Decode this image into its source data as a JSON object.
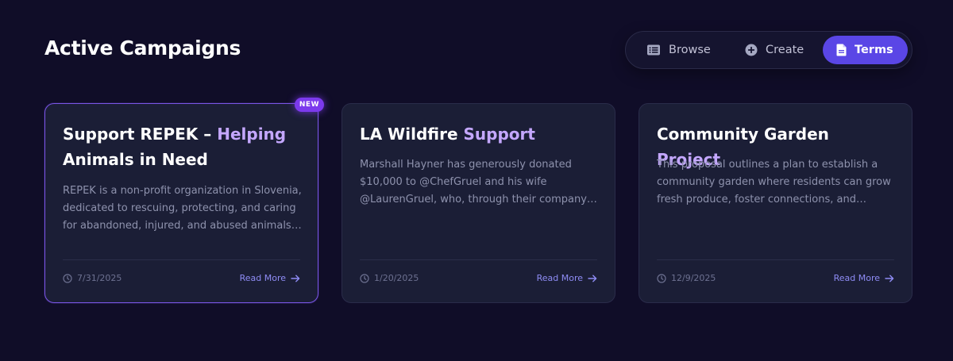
{
  "header": {
    "title": "Active Campaigns"
  },
  "tabs": [
    {
      "label": "Browse",
      "icon": "list-icon",
      "active": false
    },
    {
      "label": "Create",
      "icon": "plus-circle-icon",
      "active": false
    },
    {
      "label": "Terms",
      "icon": "document-icon",
      "active": true
    }
  ],
  "colors": {
    "background": "#100d28",
    "card": "#1b1e36",
    "accent": "#5a46e6",
    "title_highlight": "#c4a7ff",
    "badge": "#7c3aed"
  },
  "cards": [
    {
      "title_plain": "Support REPEK – ",
      "title_accent": "Helping",
      "title_rest": " Animals in Need",
      "badge": "NEW",
      "description": "REPEK is a non-profit organization in Slovenia, dedicated to rescuing, protecting, and caring for abandoned, injured, and abused animals. They…",
      "date": "7/31/2025",
      "link_label": "Read More"
    },
    {
      "title_plain": "LA Wildfire ",
      "title_accent": "Support",
      "title_rest": "",
      "description": "Marshall Hayner has generously donated $10,000 to @ChefGruel and his wife @LaurenGruel, who, through their company…",
      "date": "1/20/2025",
      "link_label": "Read More"
    },
    {
      "title_plain": "Community Garden ",
      "title_accent": "Project",
      "title_rest": "",
      "description": "This proposal outlines a plan to establish a community garden where residents can grow fresh produce, foster connections, and promo…",
      "date": "12/9/2025",
      "link_label": "Read More"
    }
  ]
}
